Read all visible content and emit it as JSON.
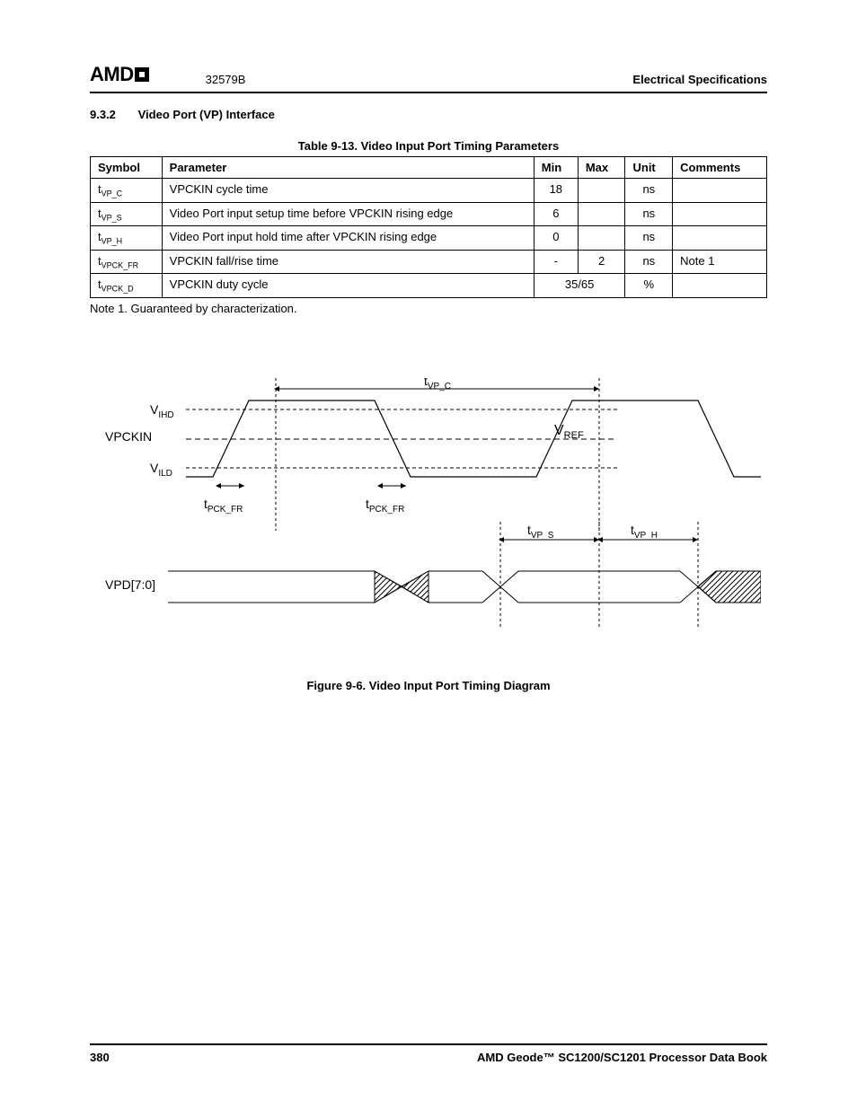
{
  "header": {
    "logo_text": "AMD",
    "doc_number": "32579B",
    "section_title": "Electrical Specifications"
  },
  "section": {
    "number": "9.3.2",
    "title": "Video Port (VP) Interface"
  },
  "table": {
    "caption": "Table 9-13.  Video Input Port Timing Parameters",
    "headers": [
      "Symbol",
      "Parameter",
      "Min",
      "Max",
      "Unit",
      "Comments"
    ],
    "rows": [
      {
        "sym_t": "t",
        "sym_sub": "VP_C",
        "param": "VPCKIN cycle time",
        "min": "18",
        "max": "",
        "unit": "ns",
        "comments": ""
      },
      {
        "sym_t": "t",
        "sym_sub": "VP_S",
        "param": "Video Port input setup time before VPCKIN rising edge",
        "min": "6",
        "max": "",
        "unit": "ns",
        "comments": ""
      },
      {
        "sym_t": "t",
        "sym_sub": "VP_H",
        "param": "Video Port input hold time after VPCKIN rising edge",
        "min": "0",
        "max": "",
        "unit": "ns",
        "comments": ""
      },
      {
        "sym_t": "t",
        "sym_sub": "VPCK_FR",
        "param": "VPCKIN fall/rise time",
        "min": "-",
        "max": "2",
        "unit": "ns",
        "comments": "Note 1"
      },
      {
        "sym_t": "t",
        "sym_sub": "VPCK_D",
        "param": "VPCKIN duty cycle",
        "min": "35/65",
        "max": "__MERGE__",
        "unit": "%",
        "comments": ""
      }
    ]
  },
  "note": "Note 1.   Guaranteed by characterization.",
  "figure": {
    "caption": "Figure 9-6.  Video Input Port Timing Diagram",
    "labels": {
      "t_vp_c": {
        "t": "t",
        "sub": "VP_C"
      },
      "v_ihd": {
        "t": "V",
        "sub": "IHD"
      },
      "v_ild": {
        "t": "V",
        "sub": "ILD"
      },
      "v_ref": {
        "t": "V",
        "sub": "REF"
      },
      "vpckin": "VPCKIN",
      "t_pck_fr_1": {
        "t": "t",
        "sub": "PCK_FR"
      },
      "t_pck_fr_2": {
        "t": "t",
        "sub": "PCK_FR"
      },
      "t_vp_s": {
        "t": "t",
        "sub": "VP_S"
      },
      "t_vp_h": {
        "t": "t",
        "sub": "VP_H"
      },
      "vpd": "VPD[7:0]"
    }
  },
  "footer": {
    "page": "380",
    "book": "AMD Geode™ SC1200/SC1201 Processor Data Book"
  }
}
